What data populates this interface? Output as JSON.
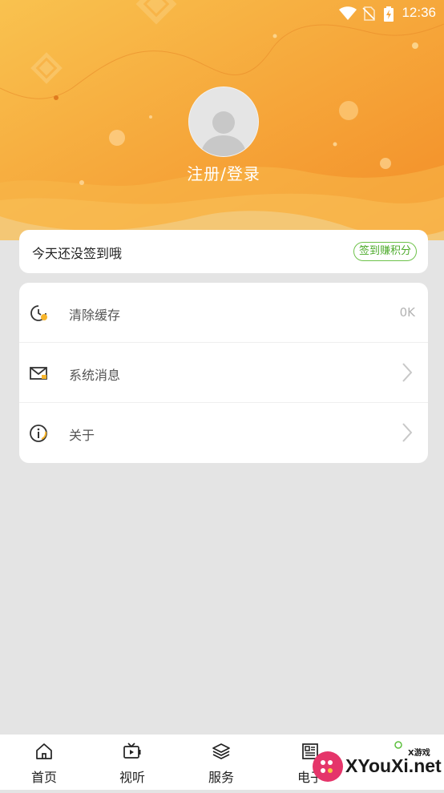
{
  "status_bar": {
    "time": "12:36",
    "icons": [
      "wifi-icon",
      "no-sim-icon",
      "battery-charging-icon"
    ]
  },
  "profile": {
    "login_label": "注册/登录",
    "avatar_icon": "default-avatar-icon"
  },
  "signin": {
    "text": "今天还没签到哦",
    "button_label": "签到赚积分"
  },
  "menu": {
    "items": [
      {
        "label": "清除缓存",
        "value": "0K",
        "icon": "clock-icon"
      },
      {
        "label": "系统消息",
        "value": "",
        "icon": "mail-icon"
      },
      {
        "label": "关于",
        "value": "",
        "icon": "info-icon"
      }
    ]
  },
  "bottom_nav": {
    "items": [
      {
        "label": "首页",
        "icon": "home-icon"
      },
      {
        "label": "视听",
        "icon": "video-icon"
      },
      {
        "label": "服务",
        "icon": "layers-icon"
      },
      {
        "label": "电子",
        "icon": "newspaper-icon"
      }
    ]
  },
  "watermark": {
    "text": "XYouXi.net",
    "small": "X游戏"
  },
  "colors": {
    "header_start": "#f8bb4a",
    "header_end": "#f4922a",
    "signin_accent": "#6ec24a",
    "background": "#e4e4e4"
  }
}
